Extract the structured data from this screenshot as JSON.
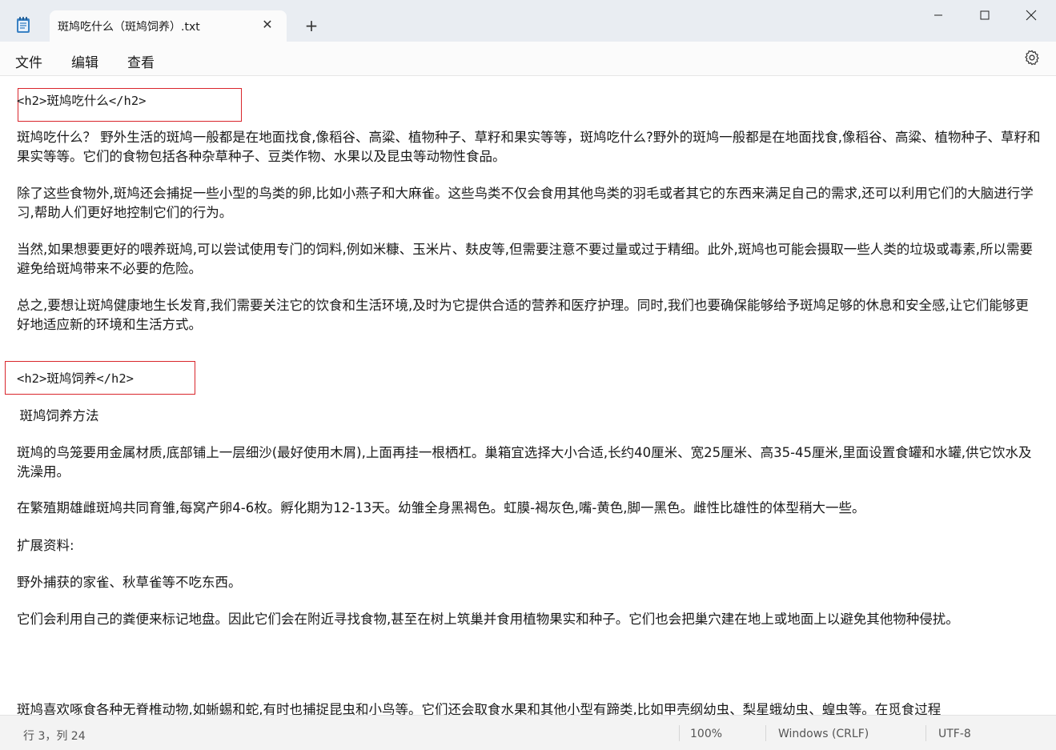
{
  "window": {
    "tab_title": "斑鸠吃什么（斑鸠饲养）.txt",
    "close_tab_glyph": "✕",
    "new_tab_glyph": "+"
  },
  "menu": {
    "file": "文件",
    "edit": "编辑",
    "view": "查看"
  },
  "editor": {
    "lines": [
      "<h2>斑鸠吃什么</h2>",
      "斑鸠吃什么？ 野外生活的斑鸠一般都是在地面找食,像稻谷、高粱、植物种子、草籽和果实等等，斑鸠吃什么?野外的斑鸠一般都是在地面找食,像稻谷、高粱、植物种子、草籽和果实等等。它们的食物包括各种杂草种子、豆类作物、水果以及昆虫等动物性食品。",
      "除了这些食物外,斑鸠还会捕捉一些小型的鸟类的卵,比如小燕子和大麻雀。这些鸟类不仅会食用其他鸟类的羽毛或者其它的东西来满足自己的需求,还可以利用它们的大脑进行学习,帮助人们更好地控制它们的行为。",
      "当然,如果想要更好的喂养斑鸠,可以尝试使用专门的饲料,例如米糠、玉米片、麸皮等,但需要注意不要过量或过于精细。此外,斑鸠也可能会摄取一些人类的垃圾或毒素,所以需要避免给斑鸠带来不必要的危险。",
      "总之,要想让斑鸠健康地生长发育,我们需要关注它的饮食和生活环境,及时为它提供合适的营养和医疗护理。同时,我们也要确保能够给予斑鸠足够的休息和安全感,让它们能够更好地适应新的环境和生活方式。",
      "<h2>斑鸠饲养</h2>",
      "  斑鸠饲养方法",
      "斑鸠的鸟笼要用金属材质,底部铺上一层细沙(最好使用木屑),上面再挂一根栖杠。巢箱宜选择大小合适,长约40厘米、宽25厘米、高35-45厘米,里面设置食罐和水罐,供它饮水及洗澡用。",
      "在繁殖期雄雌斑鸠共同育雏,每窝产卵4-6枚。孵化期为12-13天。幼雏全身黑褐色。虹膜-褐灰色,嘴-黄色,脚一黑色。雌性比雄性的体型稍大一些。",
      "扩展资料:",
      "野外捕获的家雀、秋草雀等不吃东西。",
      "它们会利用自己的粪便来标记地盘。因此它们会在附近寻找食物,甚至在树上筑巢并食用植物果实和种子。它们也会把巢穴建在地上或地面上以避免其他物种侵扰。",
      "斑鸠喜欢啄食各种无脊椎动物,如蜥蜴和蛇,有时也捕捉昆虫和小鸟等。它们还会取食水果和其他小型有蹄类,比如甲壳纲幼虫、梨星蛾幼虫、蝗虫等。在觅食过程"
    ]
  },
  "status": {
    "position": "行 3，列 24",
    "zoom": "100%",
    "line_ending": "Windows (CRLF)",
    "encoding": "UTF-8"
  },
  "colors": {
    "highlight_box": "#d9262c",
    "titlebar": "#e9edf2",
    "editor_bg": "#ffffff"
  }
}
